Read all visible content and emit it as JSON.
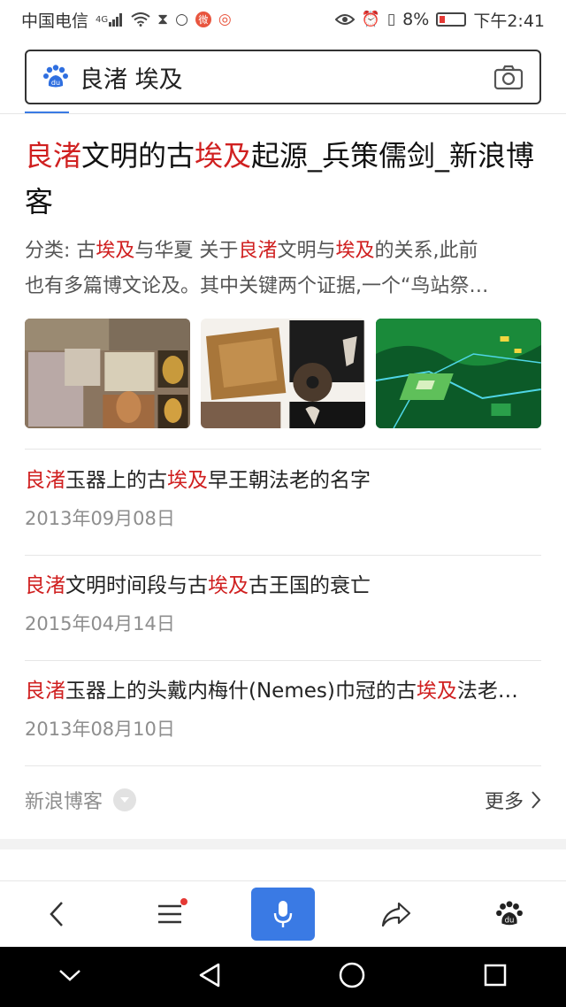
{
  "status_bar": {
    "carrier": "中国电信",
    "network": "4G",
    "battery": "8%",
    "time": "下午2:41"
  },
  "search": {
    "query": "良渚 埃及"
  },
  "result": {
    "title_parts": [
      "良渚",
      "文明的古",
      "埃及",
      "起源_兵策儒剑_新浪博客"
    ],
    "desc_line1_parts": [
      "分类: 古",
      "埃及",
      "与华夏 关于",
      "良渚",
      "文明与",
      "埃及",
      "的关系,此前"
    ],
    "desc_line2": "也有多篇博文论及。其中关键两个证据,一个“鸟站祭…"
  },
  "sub_results": [
    {
      "parts": [
        "良渚",
        "玉器上的古",
        "埃及",
        "早王朝法老的名字"
      ],
      "date": "2013年09月08日"
    },
    {
      "parts": [
        "良渚",
        "文明时间段与古",
        "埃及",
        "古王国的衰亡"
      ],
      "date": "2015年04月14日"
    },
    {
      "parts": [
        "良渚",
        "玉器上的头戴内梅什(Nemes)巾冠的古",
        "埃及",
        "法老…"
      ],
      "date": "2013年08月10日"
    }
  ],
  "source": {
    "name": "新浪博客",
    "more": "更多"
  },
  "colors": {
    "highlight": "#d02020",
    "accent": "#3a7ae4"
  }
}
